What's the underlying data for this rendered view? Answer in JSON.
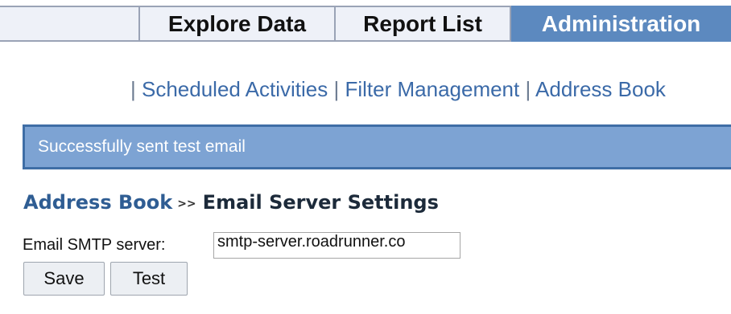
{
  "tabs": {
    "explore": "Explore Data",
    "report": "Report List",
    "admin": "Administration"
  },
  "subnav": {
    "items": [
      "Scheduled Activities",
      "Filter Management",
      "Address Book"
    ],
    "separator": "|"
  },
  "status": {
    "message": "Successfully sent test email"
  },
  "breadcrumb": {
    "parent": "Address Book",
    "separator": ">>",
    "current": "Email Server Settings"
  },
  "form": {
    "smtp_label": "Email SMTP server:",
    "smtp_value": "smtp-server.roadrunner.co"
  },
  "buttons": {
    "save": "Save",
    "test": "Test"
  },
  "colors": {
    "accent": "#5c89bf",
    "banner": "#7da3d3",
    "link": "#3b6aa8"
  }
}
